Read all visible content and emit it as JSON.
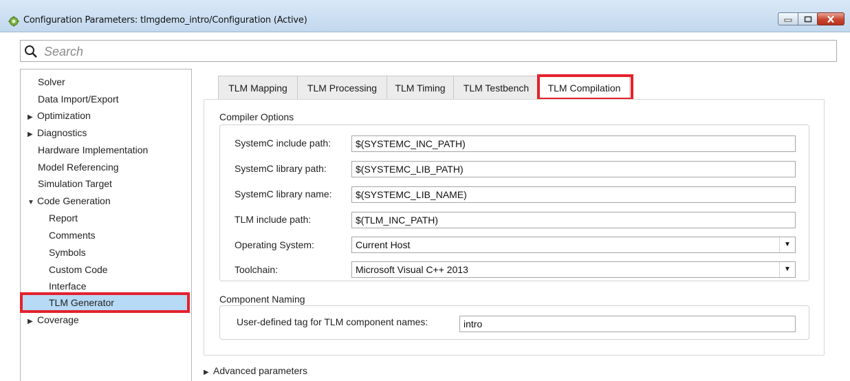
{
  "window": {
    "title": "Configuration Parameters: tlmgdemo_intro/Configuration (Active)",
    "icon": "gear-icon"
  },
  "search": {
    "placeholder": "Search"
  },
  "sidebar": {
    "items": [
      {
        "label": "Solver"
      },
      {
        "label": "Data Import/Export"
      },
      {
        "label": "Optimization",
        "arrow": "▶"
      },
      {
        "label": "Diagnostics",
        "arrow": "▶"
      },
      {
        "label": "Hardware Implementation"
      },
      {
        "label": "Model Referencing"
      },
      {
        "label": "Simulation Target"
      },
      {
        "label": "Code Generation",
        "arrow": "▼"
      },
      {
        "label": "Report"
      },
      {
        "label": "Comments"
      },
      {
        "label": "Symbols"
      },
      {
        "label": "Custom Code"
      },
      {
        "label": "Interface"
      },
      {
        "label": "TLM Generator",
        "selected": true
      },
      {
        "label": "Coverage",
        "arrow": "▶"
      }
    ]
  },
  "tabs": [
    {
      "label": "TLM Mapping"
    },
    {
      "label": "TLM Processing"
    },
    {
      "label": "TLM Timing"
    },
    {
      "label": "TLM Testbench"
    },
    {
      "label": "TLM Compilation",
      "active": true
    }
  ],
  "compiler_options": {
    "title": "Compiler Options",
    "systemc_include_path": {
      "label": "SystemC include path:",
      "value": "$(SYSTEMC_INC_PATH)"
    },
    "systemc_library_path": {
      "label": "SystemC library path:",
      "value": "$(SYSTEMC_LIB_PATH)"
    },
    "systemc_library_name": {
      "label": "SystemC library name:",
      "value": "$(SYSTEMC_LIB_NAME)"
    },
    "tlm_include_path": {
      "label": "TLM include path:",
      "value": "$(TLM_INC_PATH)"
    },
    "operating_system": {
      "label": "Operating System:",
      "value": "Current Host"
    },
    "toolchain": {
      "label": "Toolchain:",
      "value": "Microsoft Visual C++ 2013"
    }
  },
  "component_naming": {
    "title": "Component Naming",
    "tag": {
      "label": "User-defined tag for TLM component names:",
      "value": "intro"
    }
  },
  "advanced": {
    "label": "Advanced parameters",
    "arrow": "▶"
  },
  "colors": {
    "highlight": "#e4212b",
    "selection": "#b6d9f5"
  }
}
